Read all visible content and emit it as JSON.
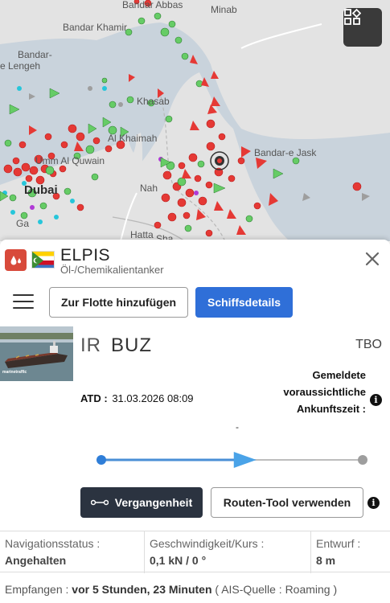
{
  "map": {
    "labels": {
      "bandar_abbas": "Bandar Abbas",
      "minab": "Minab",
      "bandar_khamir": "Bandar Khamir",
      "bandar_e": "Bandar-",
      "e_lengeh": "e Lengeh",
      "khasab": "Khasab",
      "al_khaimah": "Al Khaimah",
      "umm_al_quwain": "Umm Al Quwain",
      "bandar_e_jask": "Bandar-e Jask",
      "dubai": "Dubai",
      "nah": "Nah",
      "hatta": "Hatta",
      "sharjah_frag": "Sha",
      "garh": "Ga"
    },
    "layers_button_icon": "layers-icon"
  },
  "vessel": {
    "name": "ELPIS",
    "type": "Öl-/Chemikalientanker",
    "type_icon": "tanker-drop-icon",
    "flag": "comoros-flag"
  },
  "toolbar": {
    "add_fleet_label": "Zur Flotte hinzufügen",
    "details_label": "Schiffsdetails"
  },
  "voyage": {
    "photo_caption": "marinetraffic",
    "departure_country": "IR",
    "departure_port": "BUZ",
    "destination": "TBO",
    "eta_label": "Gemeldete voraussichtliche Ankunftszeit :",
    "atd_label": "ATD :",
    "atd_value": "31.03.2026 08:09",
    "eta_value": "-",
    "progress": 0.55
  },
  "actions": {
    "past_label": "Vergangenheit",
    "route_tool_label": "Routen-Tool verwenden"
  },
  "status": {
    "nav_label": "Navigationsstatus :",
    "nav_value": "Angehalten",
    "speed_label": "Geschwindigkeit/Kurs :",
    "speed_value": "0,1 kN / 0 °",
    "draft_label": "Entwurf :",
    "draft_value": "8 m"
  },
  "received": {
    "label": "Empfangen :",
    "value": "vor 5 Stunden, 23 Minuten",
    "source": "( AIS-Quelle : Roaming )"
  },
  "colors": {
    "primary": "#2f6fd8",
    "dark_button": "#2b3340",
    "tanker_red": "#d84a3b",
    "track_blue": "#4a8fd6"
  }
}
